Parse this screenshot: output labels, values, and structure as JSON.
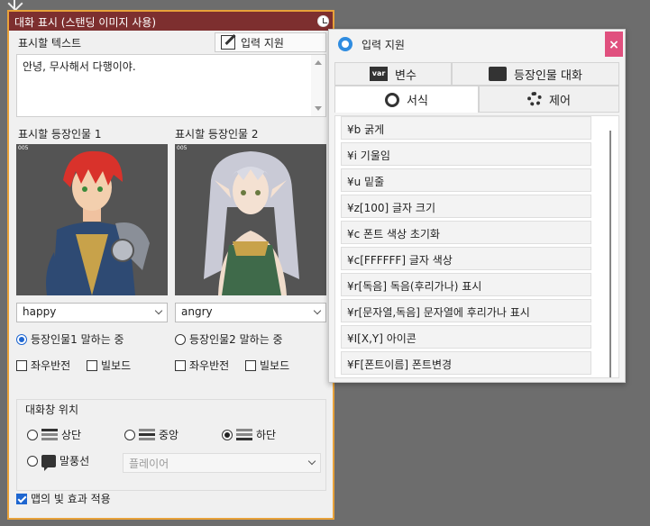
{
  "panel": {
    "title": "대화 표시 (스탠딩 이미지 사용)",
    "text_label": "표시할 텍스트",
    "input_support_button": "입력 지원",
    "text_value": "안녕, 무사해서 다행이야.",
    "char1_label": "표시할 등장인물 1",
    "char2_label": "표시할 등장인물 2",
    "char1_expression": "happy",
    "char2_expression": "angry",
    "char1_speaking": "등장인물1 말하는 중",
    "char2_speaking": "등장인물2 말하는 중",
    "flip1": "좌우반전",
    "billboard1": "빌보드",
    "flip2": "좌우반전",
    "billboard2": "빌보드",
    "portrait_tag": "005",
    "dialog_position_label": "대화창 위치",
    "pos_top": "상단",
    "pos_middle": "중앙",
    "pos_bottom": "하단",
    "pos_balloon": "말풍선",
    "balloon_target": "플레이어",
    "apply_light": "맵의 빛 효과 적용"
  },
  "popup": {
    "title": "입력 지원",
    "close": "×",
    "tabs": {
      "variables": "변수",
      "character_dialog": "등장인물 대화",
      "format": "서식",
      "control": "제어"
    },
    "items": [
      "¥b 굵게",
      "¥i 기울임",
      "¥u 밑줄",
      "¥z[100] 글자 크기",
      "¥c 폰트 색상 초기화",
      "¥c[FFFFFF] 글자 색상",
      "¥r[독음] 독음(후리가나) 표시",
      "¥r[문자열,독음] 문자열에 후리가나 표시",
      "¥I[X,Y] 아이콘",
      "¥F[폰트이름] 폰트변경"
    ]
  }
}
